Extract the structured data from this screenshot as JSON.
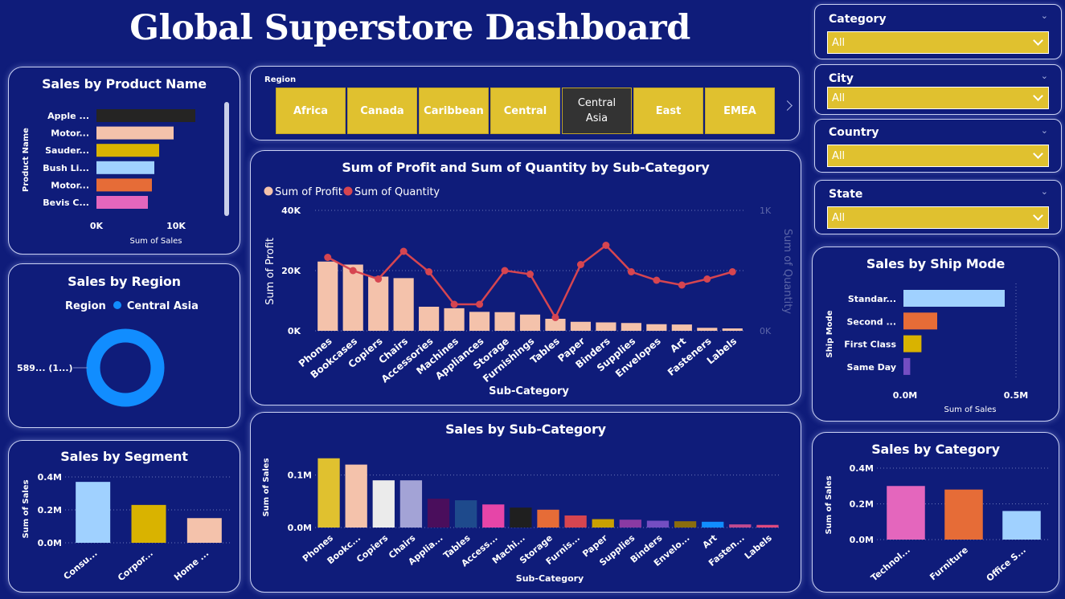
{
  "title": "Global Superstore Dashboard",
  "colors": {
    "background": "#0f1c7a",
    "slicer_yellow": "#e0c12f",
    "selected_tile": "#333333",
    "profit": "#f4c2ab",
    "quantity": "#d64550",
    "region_donut": "#118dff"
  },
  "slicers": [
    {
      "label": "Category",
      "value": "All"
    },
    {
      "label": "City",
      "value": "All"
    },
    {
      "label": "Country",
      "value": "All"
    },
    {
      "label": "State",
      "value": "All"
    }
  ],
  "region_slicer": {
    "label": "Region",
    "tiles": [
      "Africa",
      "Canada",
      "Caribbean",
      "Central",
      "Central Asia",
      "East",
      "EMEA"
    ],
    "selected": "Central Asia",
    "next_icon": "chevron-right-icon"
  },
  "product_chart": {
    "title": "Sales by Product Name",
    "ylabel": "Product Name",
    "xlabel": "Sum of Sales",
    "ticks": [
      "0K",
      "10K"
    ],
    "chart_data": {
      "type": "bar",
      "orientation": "horizontal",
      "categories": [
        "Apple ...",
        "Motor...",
        "Sauder...",
        "Bush Li...",
        "Motor...",
        "Bevis C..."
      ],
      "values": [
        12300,
        9600,
        7800,
        7200,
        6900,
        6400
      ],
      "colors": [
        "#252423",
        "#f4c2ab",
        "#d9b300",
        "#a0d1ff",
        "#e66c37",
        "#e466bd"
      ],
      "xlim": [
        0,
        16000
      ]
    }
  },
  "region_chart": {
    "title": "Sales by Region",
    "legend_title": "Region",
    "legend_item": "Central Asia",
    "data_label": "589... (1...)",
    "chart_data": {
      "type": "pie",
      "categories": [
        "Central Asia"
      ],
      "values": [
        100
      ],
      "colors": [
        "#118dff"
      ]
    }
  },
  "segment_chart": {
    "title": "Sales by Segment",
    "ylabel": "Sum of Sales",
    "ticks": [
      "0.0M",
      "0.2M",
      "0.4M"
    ],
    "chart_data": {
      "type": "bar",
      "categories": [
        "Consu...",
        "Corpor...",
        "Home ..."
      ],
      "values": [
        0.37,
        0.23,
        0.15
      ],
      "colors": [
        "#a0d1ff",
        "#d9b300",
        "#f4c2ab"
      ],
      "ylim": [
        0,
        0.4
      ]
    }
  },
  "combo_chart": {
    "title": "Sum of Profit and Sum of Quantity by Sub-Category",
    "legend": [
      "Sum of Profit",
      "Sum of Quantity"
    ],
    "ylabel": "Sum of Profit",
    "y2label": "Sum of Quantity",
    "xlabel": "Sub-Category",
    "yticks": [
      "0K",
      "20K",
      "40K"
    ],
    "y2ticks": [
      "0K",
      "1K"
    ],
    "chart_data": {
      "type": "bar",
      "categories": [
        "Phones",
        "Bookcases",
        "Copiers",
        "Chairs",
        "Accessories",
        "Machines",
        "Appliances",
        "Storage",
        "Furnishings",
        "Tables",
        "Paper",
        "Binders",
        "Supplies",
        "Envelopes",
        "Art",
        "Fasteners",
        "Labels"
      ],
      "series": [
        {
          "name": "Sum of Profit",
          "type": "bar",
          "values": [
            23000,
            22000,
            18000,
            17500,
            8000,
            7500,
            6300,
            6200,
            5400,
            4000,
            3000,
            2800,
            2600,
            2200,
            2100,
            1000,
            800
          ]
        },
        {
          "name": "Sum of Quantity",
          "type": "line",
          "values": [
            610,
            500,
            430,
            660,
            490,
            220,
            220,
            500,
            470,
            110,
            550,
            710,
            490,
            420,
            380,
            430,
            490
          ]
        }
      ],
      "ylim": [
        0,
        40000
      ],
      "y2lim": [
        0,
        1000
      ]
    }
  },
  "ship_chart": {
    "title": "Sales by Ship Mode",
    "ylabel": "Ship Mode",
    "xlabel": "Sum of Sales",
    "ticks": [
      "0.0M",
      "0.5M"
    ],
    "chart_data": {
      "type": "bar",
      "orientation": "horizontal",
      "categories": [
        "Standar...",
        "Second ...",
        "First Class",
        "Same Day"
      ],
      "values": [
        0.45,
        0.15,
        0.08,
        0.03
      ],
      "colors": [
        "#a0d1ff",
        "#e66c37",
        "#d9b300",
        "#744ec2"
      ],
      "xlim": [
        0,
        0.5
      ]
    }
  },
  "subcat_chart": {
    "title": "Sales by Sub-Category",
    "ylabel": "Sum of Sales",
    "xlabel": "Sub-Category",
    "ticks": [
      "0.0M",
      "0.1M"
    ],
    "chart_data": {
      "type": "bar",
      "categories": [
        "Phones",
        "Bookc...",
        "Copiers",
        "Chairs",
        "Applia...",
        "Tables",
        "Access...",
        "Machi...",
        "Storage",
        "Furnis...",
        "Paper",
        "Supplies",
        "Binders",
        "Envelo...",
        "Art",
        "Fasten...",
        "Labels"
      ],
      "values": [
        0.132,
        0.12,
        0.09,
        0.09,
        0.055,
        0.052,
        0.044,
        0.038,
        0.034,
        0.023,
        0.016,
        0.015,
        0.013,
        0.012,
        0.011,
        0.006,
        0.005
      ],
      "colors": [
        "#e0c12f",
        "#f4c2ab",
        "#ebebeb",
        "#a3a3d6",
        "#4a0e5c",
        "#1e4a8c",
        "#e645a8",
        "#1f1f1f",
        "#e66c37",
        "#d64550",
        "#c9a000",
        "#8a3aa3",
        "#744ec2",
        "#8a6d0e",
        "#118dff",
        "#c04a8f",
        "#e04a7f"
      ],
      "ylim": [
        0,
        0.15
      ]
    }
  },
  "category_chart": {
    "title": "Sales by Category",
    "ylabel": "Sum of Sales",
    "ticks": [
      "0.0M",
      "0.2M",
      "0.4M"
    ],
    "chart_data": {
      "type": "bar",
      "categories": [
        "Technol...",
        "Furniture",
        "Office S..."
      ],
      "values": [
        0.3,
        0.28,
        0.16
      ],
      "colors": [
        "#e466bd",
        "#e66c37",
        "#a0d1ff"
      ],
      "ylim": [
        0,
        0.4
      ]
    }
  }
}
